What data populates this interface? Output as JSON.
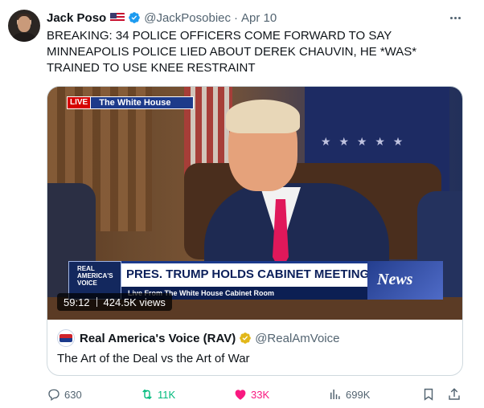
{
  "author": {
    "name": "Jack Poso",
    "handle": "@JackPosobiec",
    "separator": "·",
    "date": "Apr 10"
  },
  "tweet_text": "BREAKING: 34 POLICE OFFICERS COME FORWARD TO SAY MINNEAPOLIS POLICE LIED ABOUT DEREK CHAUVIN, HE *WAS* TRAINED TO USE KNEE RESTRAINT",
  "media": {
    "live_tag": "LIVE",
    "live_title": "The White House",
    "logo_text": [
      "REAL",
      "AMERICA'S",
      "VOICE"
    ],
    "chyron_title": "PRES. TRUMP HOLDS CABINET MEETING",
    "chyron_subtitle": "Live From The White House Cabinet Room",
    "network_mark": "News",
    "duration": "59:12",
    "views": "424.5K views"
  },
  "quoted": {
    "name": "Real America's Voice (RAV)",
    "handle": "@RealAmVoice",
    "text": "The Art of the Deal vs the Art of War"
  },
  "actions": {
    "replies": "630",
    "retweets": "11K",
    "likes": "33K",
    "views": "699K"
  },
  "colors": {
    "verified_blue": "#1d9bf0",
    "business_gold": "#e2b719",
    "retweet_green": "#00ba7c",
    "like_pink": "#f91880",
    "secondary_text": "#536471"
  },
  "icons": {
    "more": "more-horizontal-icon",
    "verified": "verified-badge-icon",
    "reply": "reply-icon",
    "retweet": "retweet-icon",
    "like": "heart-filled-icon",
    "views": "analytics-icon",
    "bookmark": "bookmark-icon",
    "share": "share-icon"
  }
}
